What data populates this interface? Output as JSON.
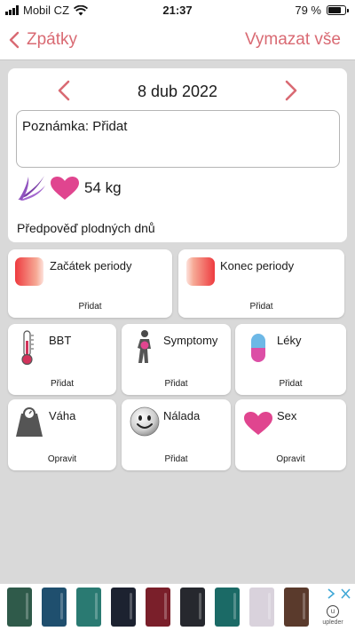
{
  "status_bar": {
    "carrier": "Mobil CZ",
    "time": "21:37",
    "battery": "79 %",
    "battery_level": 0.79
  },
  "nav": {
    "back_label": "Zpátky",
    "clear_label": "Vymazat vše"
  },
  "day": {
    "date": "8 dub 2022",
    "note": "Poznámka: Přidat",
    "weight": "54 kg",
    "fertile_prediction": "Předpověď plodných dnů"
  },
  "tiles": {
    "period_start": {
      "label": "Začátek periody",
      "action": "Přidat"
    },
    "period_end": {
      "label": "Konec periody",
      "action": "Přidat"
    },
    "bbt": {
      "label": "BBT",
      "action": "Přidat"
    },
    "symptoms": {
      "label": "Symptomy",
      "action": "Přidat"
    },
    "meds": {
      "label": "Léky",
      "action": "Přidat"
    },
    "weight": {
      "label": "Váha",
      "action": "Opravit"
    },
    "mood": {
      "label": "Nálada",
      "action": "Přidat"
    },
    "sex": {
      "label": "Sex",
      "action": "Opravit"
    }
  },
  "ad": {
    "brand": "upleder",
    "product_colors": [
      "#2f5a4a",
      "#1f4f6e",
      "#2a7a72",
      "#1c2230",
      "#7a1f2a",
      "#26282e",
      "#1b6a66",
      "#d9d2dc",
      "#5a3a2c"
    ]
  },
  "colors": {
    "accent": "#d96a73",
    "heart": "#e0458f",
    "background": "#d9d9d9"
  }
}
